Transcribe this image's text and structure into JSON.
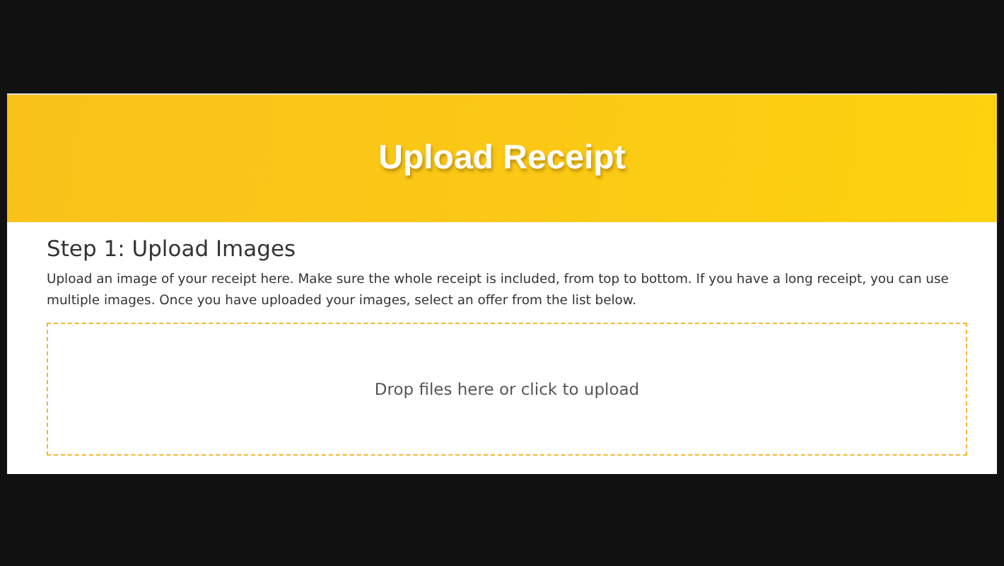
{
  "banner": {
    "title": "Upload Receipt"
  },
  "step": {
    "heading": "Step 1: Upload Images",
    "description": "Upload an image of your receipt here. Make sure the whole receipt is included, from top to bottom. If you have a long receipt, you can use multiple images. Once you have uploaded your images, select an offer from the list below."
  },
  "dropzone": {
    "label": "Drop files here or click to upload"
  }
}
